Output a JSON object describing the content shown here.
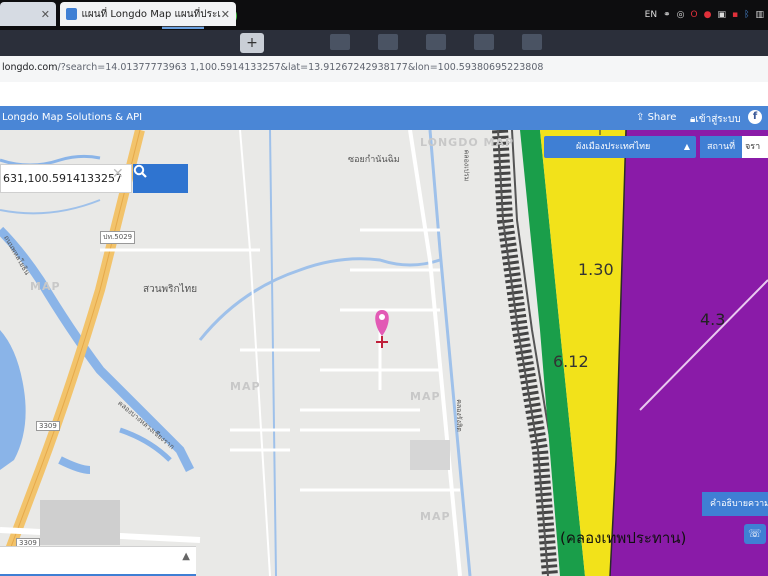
{
  "taskbar": {
    "apps": [
      {
        "name": "media-player-icon",
        "color": "#e8a33c",
        "glyph": "▶"
      },
      {
        "name": "opera-icon",
        "color": "#d41a24",
        "glyph": "O"
      },
      {
        "name": "excel-icon",
        "color": "#1f7a45",
        "glyph": "X"
      },
      {
        "name": "chrome-icon",
        "color": "#3a9a4d",
        "glyph": "◉"
      },
      {
        "name": "line-icon",
        "color": "#3fbf3f",
        "glyph": "LINE"
      }
    ],
    "tray_lang": "EN"
  },
  "browser": {
    "tab1_label": "",
    "tab2_label": "แผนที่ Longdo Map แผนที่ประเท",
    "url_host": "longdo.com",
    "url_rest": "/?search=14.01377773963 1,100.5914133257&lat=13.91267242938177&lon=100.59380695223808"
  },
  "site": {
    "brand": "Longdo Map Solutions & API",
    "share_label": "Share",
    "login_label": "เข้าสู่ระบบ",
    "fb_label": "f"
  },
  "map": {
    "search_value": "631,100.5914133257",
    "search_clear": "✕",
    "layer_label": "ผังเมืองประเทศไทย",
    "place_label": "สถานที่",
    "place_input": "จรา",
    "legend_label": "คำอธิบายความ",
    "labels": {
      "soi": "ซอยกำนันฉิม",
      "garden": "สวนพริกไทย",
      "road_5029": "ปท.5029",
      "road_3309": "3309",
      "road_3309b": "3309",
      "canal": "คลองบางหลวงเชียงราก",
      "canal2": "คลองรังสิต",
      "canal3": "คลองเปรม",
      "road_1": "ถนนพหลโยธิน"
    },
    "zones": {
      "z1": "1.30",
      "z2": "4.3",
      "z3": "6.12",
      "bottom_text": "(คลองเทพประทาน)"
    },
    "watermarks": [
      "LONGDO MAP",
      "MAP",
      "MAP",
      "MAP",
      "MAP"
    ]
  },
  "colors": {
    "sitebar": "#4a86d6",
    "yellow_zone": "#f2e21a",
    "purple_zone": "#8a1ba8",
    "green_zone": "#1a9e4a",
    "water": "#8ab4e8",
    "pin": "#e25ab5"
  }
}
